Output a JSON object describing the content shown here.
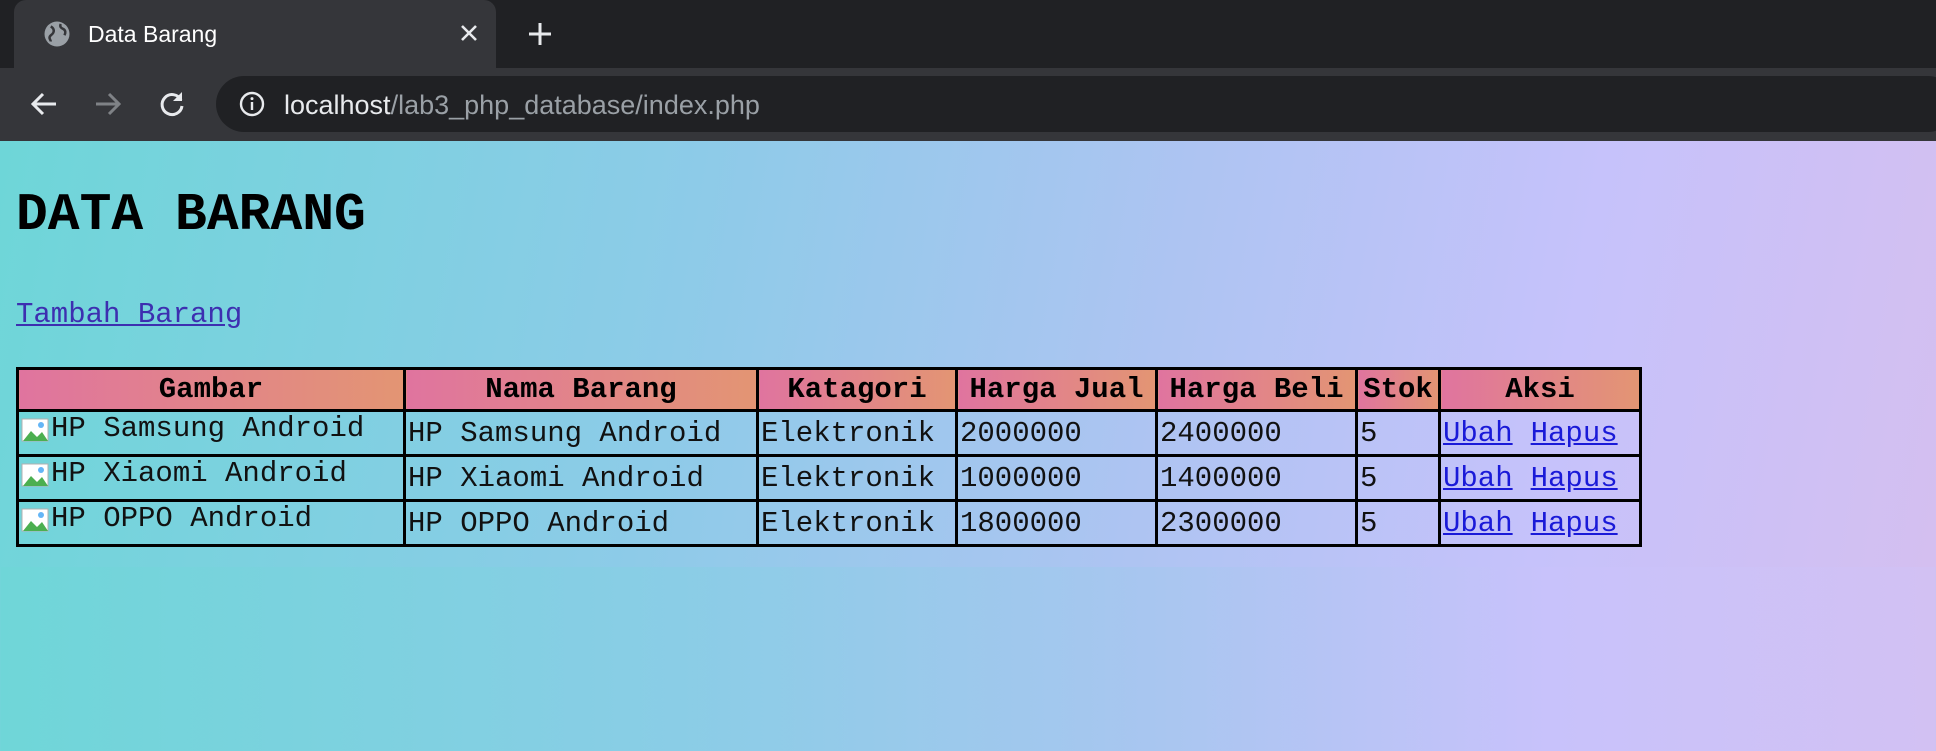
{
  "browser": {
    "tab_title": "Data Barang",
    "url_host": "localhost",
    "url_path": "/lab3_php_database/index.php",
    "colors": {
      "frame": "#202124",
      "toolbar": "#35363a",
      "text": "#e8eaed",
      "muted": "#9aa0a6"
    },
    "icons": [
      "globe-icon",
      "close-icon",
      "plus-icon",
      "back-arrow-icon",
      "forward-arrow-icon",
      "reload-icon",
      "info-icon"
    ]
  },
  "page": {
    "heading": "DATA BARANG",
    "add_link": "Tambah Barang",
    "table": {
      "headers": [
        "Gambar",
        "Nama Barang",
        "Katagori",
        "Harga Jual",
        "Harga Beli",
        "Stok",
        "Aksi"
      ],
      "rows": [
        {
          "gambar_alt": "HP Samsung Android",
          "nama": "HP Samsung Android",
          "kategori": "Elektronik",
          "harga_jual": "2000000",
          "harga_beli": "2400000",
          "stok": "5",
          "ubah": "Ubah",
          "hapus": "Hapus"
        },
        {
          "gambar_alt": "HP Xiaomi Android",
          "nama": "HP Xiaomi Android",
          "kategori": "Elektronik",
          "harga_jual": "1000000",
          "harga_beli": "1400000",
          "stok": "5",
          "ubah": "Ubah",
          "hapus": "Hapus"
        },
        {
          "gambar_alt": "HP OPPO Android",
          "nama": "HP OPPO Android",
          "kategori": "Elektronik",
          "harga_jual": "1800000",
          "harga_beli": "2300000",
          "stok": "5",
          "ubah": "Ubah",
          "hapus": "Hapus"
        }
      ]
    },
    "colors": {
      "header_start": "#e0749f",
      "header_end": "#e39573",
      "link": "#1a1ad8"
    }
  }
}
